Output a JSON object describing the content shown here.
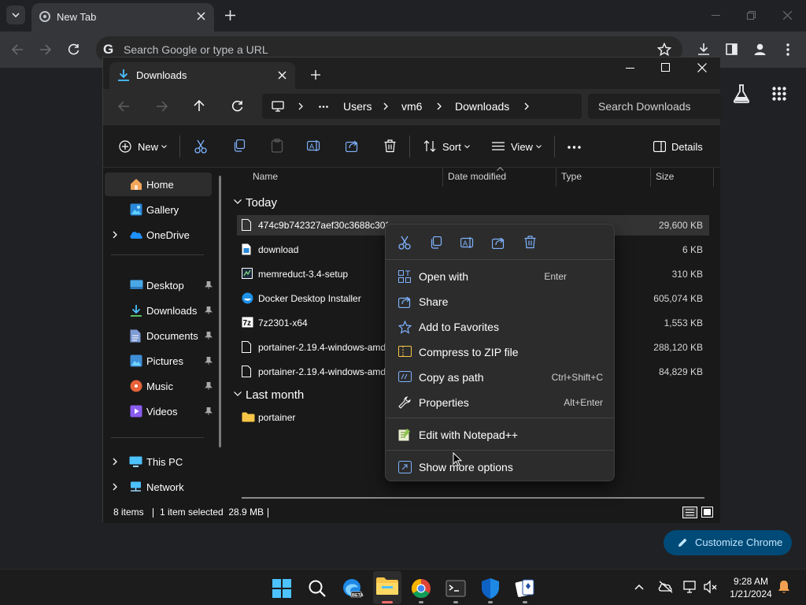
{
  "chrome": {
    "tab_title": "New Tab",
    "omnibox_placeholder": "Search Google or type a URL",
    "customize_label": "Customize Chrome"
  },
  "explorer": {
    "tab_title": "Downloads",
    "breadcrumb": [
      "Users",
      "vm6",
      "Downloads"
    ],
    "search_placeholder": "Search Downloads",
    "commands": {
      "new": "New",
      "sort": "Sort",
      "view": "View",
      "details": "Details"
    },
    "nav": {
      "home": "Home",
      "gallery": "Gallery",
      "onedrive": "OneDrive",
      "desktop": "Desktop",
      "downloads": "Downloads",
      "documents": "Documents",
      "pictures": "Pictures",
      "music": "Music",
      "videos": "Videos",
      "thispc": "This PC",
      "network": "Network"
    },
    "columns": [
      "Name",
      "Date modified",
      "Type",
      "Size"
    ],
    "groups": {
      "today": "Today",
      "last_month": "Last month"
    },
    "files": [
      {
        "name": "474c9b742327aef30c3688c3021f13",
        "size": "29,600 KB",
        "selected": true
      },
      {
        "name": "download",
        "size": "6 KB"
      },
      {
        "name": "memreduct-3.4-setup",
        "size": "310 KB"
      },
      {
        "name": "Docker Desktop Installer",
        "size": "605,074 KB"
      },
      {
        "name": "7z2301-x64",
        "size": "1,553 KB"
      },
      {
        "name": "portainer-2.19.4-windows-amd",
        "size": "288,120 KB"
      },
      {
        "name": "portainer-2.19.4-windows-amd",
        "size": "84,829 KB"
      }
    ],
    "folders": [
      {
        "name": "portainer"
      }
    ],
    "status": {
      "items": "8 items",
      "selection": "1 item selected  28.9 MB"
    }
  },
  "context_menu": {
    "items": [
      {
        "label": "Open with",
        "shortcut": "Enter"
      },
      {
        "label": "Share",
        "shortcut": ""
      },
      {
        "label": "Add to Favorites",
        "shortcut": ""
      },
      {
        "label": "Compress to ZIP file",
        "shortcut": ""
      },
      {
        "label": "Copy as path",
        "shortcut": "Ctrl+Shift+C"
      },
      {
        "label": "Properties",
        "shortcut": "Alt+Enter"
      },
      {
        "label": "Edit with Notepad++",
        "shortcut": ""
      },
      {
        "label": "Show more options",
        "shortcut": ""
      }
    ]
  },
  "taskbar": {
    "time": "9:28 AM",
    "date": "1/21/2024"
  },
  "colors": {
    "accent": "#4cc2ff",
    "folder": "#f7c548",
    "customize_bg": "#004a77"
  }
}
